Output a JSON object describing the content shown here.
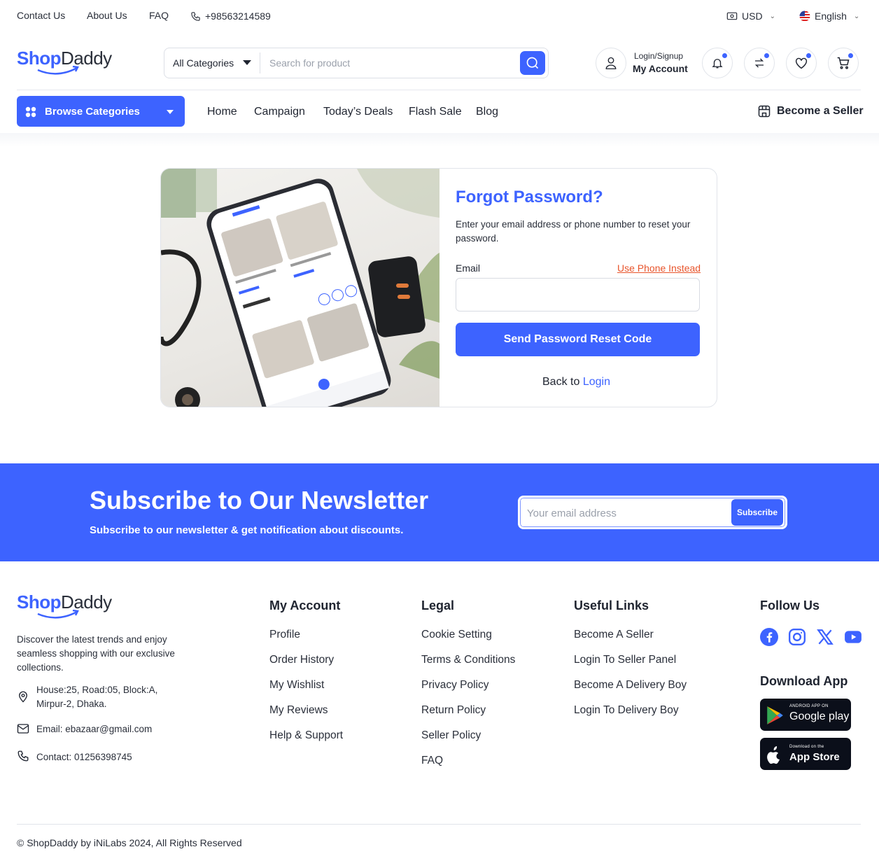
{
  "topbar": {
    "links": [
      "Contact Us",
      "About Us",
      "FAQ"
    ],
    "phone": "+98563214589",
    "currency": "USD",
    "language": "English"
  },
  "brand": {
    "shop": "Shop",
    "daddy": "Daddy"
  },
  "search": {
    "category": "All Categories",
    "placeholder": "Search for product"
  },
  "account": {
    "top": "Login/Signup",
    "bottom": "My Account"
  },
  "nav": {
    "browse": "Browse Categories",
    "links": [
      "Home",
      "Campaign",
      "Today’s Deals",
      "Flash Sale",
      "Blog"
    ],
    "seller": "Become a Seller"
  },
  "forgot": {
    "title": "Forgot Password?",
    "description": "Enter your email address or phone number to reset your password.",
    "email_label": "Email",
    "phone_link": "Use Phone Instead",
    "email_value": "",
    "send_button": "Send Password Reset Code",
    "back_text": "Back to",
    "login_link": "Login"
  },
  "newsletter": {
    "title": "Subscribe to Our Newsletter",
    "subtitle": "Subscribe to our newsletter & get notification about discounts.",
    "placeholder": "Your email address",
    "button": "Subscribe"
  },
  "footer": {
    "about": "Discover the latest trends and enjoy seamless shopping with our exclusive collections.",
    "address": "House:25, Road:05, Block:A, Mirpur-2, Dhaka.",
    "email": "Email: ebazaar@gmail.com",
    "contact": "Contact: 01256398745",
    "my_account": {
      "title": "My Account",
      "links": [
        "Profile",
        "Order History",
        "My Wishlist",
        "My Reviews",
        "Help & Support"
      ]
    },
    "legal": {
      "title": "Legal",
      "links": [
        "Cookie Setting",
        "Terms & Conditions",
        "Privacy Policy",
        "Return Policy",
        "Seller Policy",
        "FAQ"
      ]
    },
    "useful": {
      "title": "Useful Links",
      "links": [
        "Become A Seller",
        "Login To Seller Panel",
        "Become A Delivery Boy",
        "Login To Delivery Boy"
      ]
    },
    "follow_title": "Follow Us",
    "download_title": "Download App",
    "google_small": "ANDROID APP ON",
    "google_big": "Google play",
    "apple_small": "Download on the",
    "apple_big": "App Store",
    "copyright": "© ShopDaddy by iNiLabs 2024, All Rights Reserved"
  },
  "colors": {
    "primary": "#3d63ff",
    "accent_orange": "#e8542b",
    "dark": "#1f2430"
  }
}
